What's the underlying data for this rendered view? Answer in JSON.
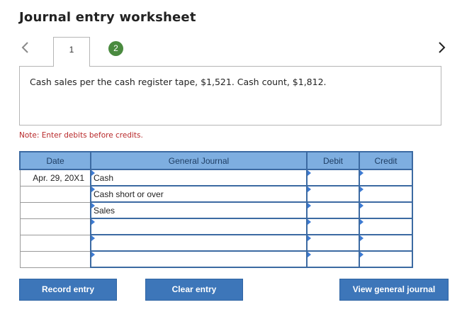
{
  "header": {
    "title": "Journal entry worksheet"
  },
  "tabs": [
    {
      "label": "1",
      "active": true
    },
    {
      "label": "2",
      "completed": true
    }
  ],
  "description": "Cash sales per the cash register tape, $1,521. Cash count, $1,812.",
  "note": "Note: Enter debits before credits.",
  "table": {
    "headers": {
      "date": "Date",
      "account": "General Journal",
      "debit": "Debit",
      "credit": "Credit"
    },
    "rows": [
      {
        "date": "Apr. 29, 20X1",
        "account": "Cash",
        "debit": "",
        "credit": ""
      },
      {
        "date": "",
        "account": "Cash short or over",
        "debit": "",
        "credit": ""
      },
      {
        "date": "",
        "account": "Sales",
        "debit": "",
        "credit": ""
      },
      {
        "date": "",
        "account": "",
        "debit": "",
        "credit": ""
      },
      {
        "date": "",
        "account": "",
        "debit": "",
        "credit": ""
      },
      {
        "date": "",
        "account": "",
        "debit": "",
        "credit": ""
      }
    ]
  },
  "buttons": {
    "record": "Record entry",
    "clear": "Clear entry",
    "view": "View general journal"
  },
  "colors": {
    "header_bg": "#7eaee0",
    "grid_border": "#3c6aa2",
    "button_bg": "#3d76b9",
    "tab_badge": "#4a8a3f",
    "note_text": "#b8282a"
  },
  "icons": {
    "prev": "chevron-left-icon",
    "next": "chevron-right-icon",
    "dropdown": "triangle-marker-icon"
  }
}
